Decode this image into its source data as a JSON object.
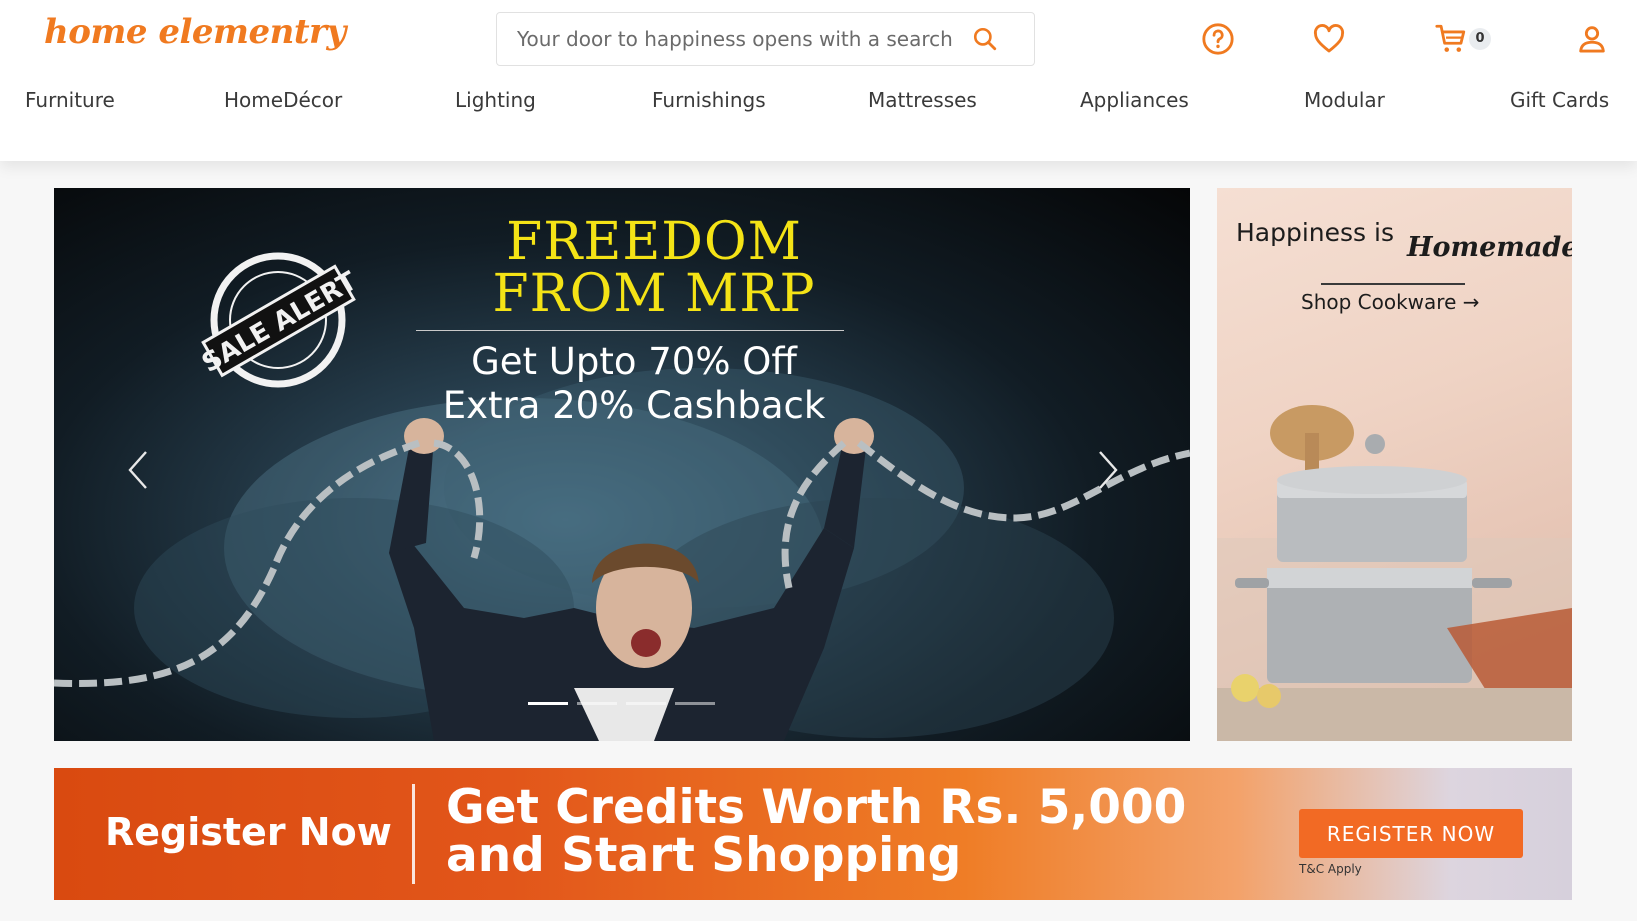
{
  "brand": {
    "logo": "home elementry",
    "accent": "#f07a20"
  },
  "search": {
    "placeholder": "Your door to happiness opens with a search ...",
    "icon": "search-icon"
  },
  "header_icons": [
    {
      "name": "help-icon"
    },
    {
      "name": "heart-icon"
    },
    {
      "name": "cart-icon",
      "badge": "0"
    },
    {
      "name": "user-icon"
    }
  ],
  "nav": [
    "Furniture",
    "HomeDécor",
    "Lighting",
    "Furnishings",
    "Mattresses",
    "Appliances",
    "Modular",
    "Gift Cards"
  ],
  "hero": {
    "title_line1": "FREEDOM",
    "title_line2": "FROM MRP",
    "sub_line1": "Get Upto 70% Off",
    "sub_line2": "Extra 20% Cashback",
    "stamp_text": "SALE ALERT",
    "slides_total": 4,
    "active_slide": 1
  },
  "side_banner": {
    "title": "Happiness is",
    "script": "Homemade",
    "link": "Shop Cookware →"
  },
  "register_banner": {
    "left_text": "Register Now",
    "headline_line1": "Get Credits Worth Rs. 5,000",
    "headline_line2": "and Start Shopping",
    "button": "REGISTER NOW",
    "tnc": "T&C Apply"
  }
}
